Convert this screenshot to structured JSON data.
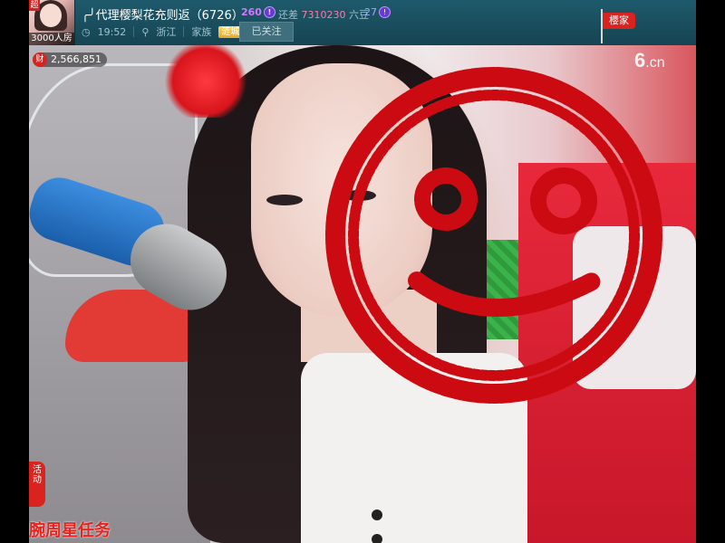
{
  "header": {
    "avatar_badge": "超",
    "avatar_caption": "3000人房",
    "host_name": "╭╯代理樱梨花充则返（6726）",
    "level_a": "260",
    "gap_label": "还差",
    "gap_value": "7310230",
    "gap_unit": "六豆",
    "level_b": "27",
    "time": "19:52",
    "location": "浙江",
    "clan_label": "家族",
    "clan_badge": "涟城",
    "follow_button": "已关注",
    "flag_label": "樱家"
  },
  "video": {
    "wealth_icon": "财",
    "wealth_value": "2,566,851",
    "logo_digit": "6",
    "logo_suffix": ".cn",
    "activity_tab": "活动",
    "task_text": "腕周星任务",
    "smiley_color": "#cc0a12"
  }
}
